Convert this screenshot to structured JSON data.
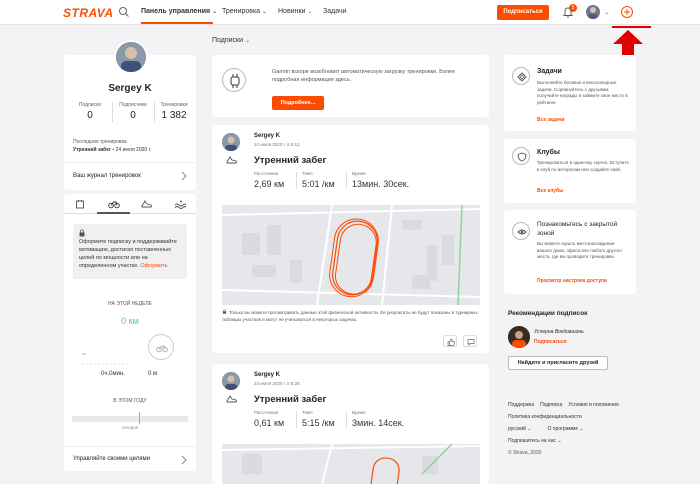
{
  "nav": {
    "logo": "STRAVA",
    "dashboard": "Панель управления",
    "training": "Тренировка",
    "news": "Новинки",
    "tasks": "Задачи",
    "subscribe": "Подписаться",
    "notifications_count": "5"
  },
  "profile": {
    "name": "Sergey K",
    "subscriptions_label": "Подписки",
    "subscriptions": "0",
    "subscribers_label": "Подписчики",
    "subscribers": "0",
    "trainings_label": "Тренировки",
    "trainings": "1 382",
    "last_label": "Последняя тренировка",
    "last_name": "Утренний забег",
    "last_date": " • 24 июля 2020 г.",
    "journal": "Ваш журнал тренировок"
  },
  "progress": {
    "promo_text": "Оформите подписку и поддерживайте мотивацию, достигая поставленных целей по мощности или на определенном участке.",
    "promo_link": "Оформить",
    "week_label": "НА ЭТОЙ НЕДЕЛЕ",
    "week_km": "0 км",
    "week_time": "0ч.0мин.",
    "week_m": "0 м",
    "year_label": "В ЭТОМ ГОДУ",
    "today": "сегодня",
    "goals": "Управляйте своими целями"
  },
  "feed": {
    "filter": "Подписки",
    "garmin_text": "Garmin вскоре возобновит автоматическую загрузку тренировки. Более подробная информация здесь.",
    "garmin_button": "Подробнее...",
    "activities": [
      {
        "name": "Sergey K",
        "date": "24 июля 2020 г. в 8:12",
        "title": "Утренний забег",
        "distance_label": "Расстояние",
        "distance": "2,69 км",
        "pace_label": "Темп",
        "pace": "5:01 /км",
        "time_label": "Время",
        "time": "13мин. 30сек.",
        "note": "Только вы можете просматривать данные этой физической активности. Ее результаты не будут показаны в турнирных таблицах участков и могут не учитываться в некоторых задачах."
      },
      {
        "name": "Sergey K",
        "date": "24 июля 2020 г. в 8:28",
        "title": "Утренний забег",
        "distance_label": "Расстояние",
        "distance": "0,61 км",
        "pace_label": "Темп",
        "pace": "5:15 /км",
        "time_label": "Время",
        "time": "3мин. 14сек."
      }
    ]
  },
  "sidebar": {
    "challenges_title": "Задачи",
    "challenges_text": "Выполняйте беговые и велосипедные задачи. Соревнуйтесь с друзьями, получайте награды и займите свое место в рейтинге.",
    "challenges_link": "Все задачи",
    "clubs_title": "Клубы",
    "clubs_text": "Тренироваться в одиночку скучно. Вступите в клуб по интересам или создайте свой.",
    "clubs_link": "Все клубы",
    "privacy_title": "Познакомьтесь с закрытой зоной",
    "privacy_text": "Вы можете скрыть местонахождение вашего дома, офиса или любого другого места, где вы проводите тренировки.",
    "privacy_link": "Просмотр настроек доступа",
    "rec_title": "Рекомендации подписок",
    "rec_name": "Усперна Вохдовшонь",
    "rec_subscribe": "Подписаться",
    "invite": "Найдите и пригласите друзей"
  },
  "footer": {
    "support": "Поддержка",
    "subscription": "Подписка",
    "terms": "Условия и положения",
    "privacy": "Политика конфиденциальности",
    "language": "русский",
    "about": "О программе",
    "follow": "Подпишитесь на нас",
    "copyright": "© Strava, 2020"
  },
  "colors": {
    "brand": "#fc4c02",
    "route": "#fc4c02",
    "annotation": "#e00000"
  }
}
